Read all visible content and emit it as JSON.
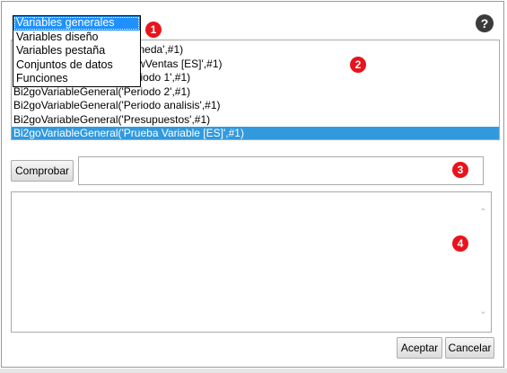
{
  "help": {
    "label": "?"
  },
  "markers": [
    "1",
    "2",
    "3",
    "4"
  ],
  "dropdown": {
    "options": [
      "Variables generales",
      "Variables diseño",
      "Variables pestaña",
      "Conjuntos de datos",
      "Funciones"
    ],
    "selected_index": 0
  },
  "list": {
    "items": [
      "Bi2goVariableGeneral('Moneda',#1)",
      "Bi2goVariableGeneral('NewVentas [ES]',#1)",
      "Bi2goVariableGeneral('Periodo 1',#1)",
      "Bi2goVariableGeneral('Periodo 2',#1)",
      "Bi2goVariableGeneral('Periodo analisis',#1)",
      "Bi2goVariableGeneral('Presupuestos',#1)",
      "Bi2goVariableGeneral('Prueba Variable [ES]',#1)"
    ],
    "selected_index": 6
  },
  "check": {
    "button_label": "Comprobar",
    "value": ""
  },
  "result": {
    "value": ""
  },
  "footer": {
    "accept_label": "Aceptar",
    "cancel_label": "Cancelar"
  },
  "colors": {
    "selection": "#3399dd",
    "marker": "#e8141c"
  }
}
